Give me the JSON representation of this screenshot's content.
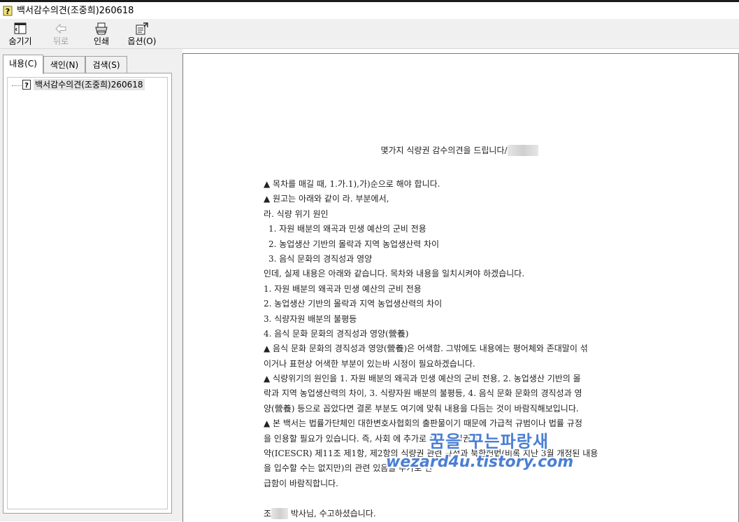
{
  "window": {
    "title": "백서감수의견(조중희)260618"
  },
  "toolbar": {
    "hide_label": "숨기기",
    "back_label": "뒤로",
    "print_label": "인쇄",
    "options_label": "옵션(O)"
  },
  "tabs": {
    "contents": "내용(C)",
    "index": "색인(N)",
    "search": "검색(S)"
  },
  "tree": {
    "item_label": "백서감수의견(조중희)260618"
  },
  "doc": {
    "heading": "몇가지 식량권 감수의견을 드립니다/",
    "lines": [
      "▲ 목차를 매길 때, 1.가.1),가)순으로 해야 합니다.",
      "▲ 원고는 아래와 같이 라. 부분에서,",
      "라. 식량 위기 원인",
      "1. 자원 배분의 왜곡과 민생 예산의 군비 전용",
      "2. 농업생산 기반의 몰락과 지역 농업생산력 차이",
      "3. 음식 문화의 경직성과 영양",
      "인데, 실제 내용은 아래와 같습니다. 목차와 내용을 일치시켜야 하겠습니다.",
      "1. 자원 배분의 왜곡과 민생 예산의 군비 전용",
      "2. 농업생산 기반의 몰락과 지역 농업생산력의 차이",
      "3. 식량자원 배분의 불평등",
      "4. 음식 문화 문화의 경직성과 영양(營養)",
      "▲ 음식 문화 문화의 경직성과 영양(營養)은 어색함. 그밖에도 내용에는 평어체와 존대말이 섞",
      "이거나 표현상 어색한 부분이 있는바 시정이 필요하겠습니다.",
      "▲ 식량위기의 원인을 1. 자원 배분의 왜곡과 민생 예산의 군비 전용, 2. 농업생산 기반의 몰",
      "락과 지역 농업생산력의 차이, 3. 식량자원 배분의 불평등, 4. 음식 문화 문화의 경직성과 영",
      "양(營養) 등으로 꼽았다면 결론 부분도 여기에 맞춰 내용을 다듬는 것이 바람직해보입니다.",
      "▲ 본 백서는 법률가단체인 대한변호사협회의 출판물이기 때문에 가급적 규범이나 법률 규정",
      "을 인용할 필요가 있습니다. 즉, 사회                                     에 추가로 유엔 사회권규",
      "약(ICESCR) 제11조 제1항, 제2항의 식량권 관련 규정과 북한헌법(비록 지난 3월 개정된 내용",
      "을 입수할 수는 없지만)의 관련                                                  있음을 추가로 언",
      "급함이 바람직합니다."
    ],
    "closing_prefix": "조",
    "closing_suffix": " 박사님, 수고하셨습니다."
  },
  "watermark": {
    "korean": "꿈을 꾸는파랑새",
    "english": "wezard4u.tistory.com"
  },
  "colors": {
    "watermark": "#4a7fd4",
    "toolbar_bg": "#f0f0f0"
  }
}
